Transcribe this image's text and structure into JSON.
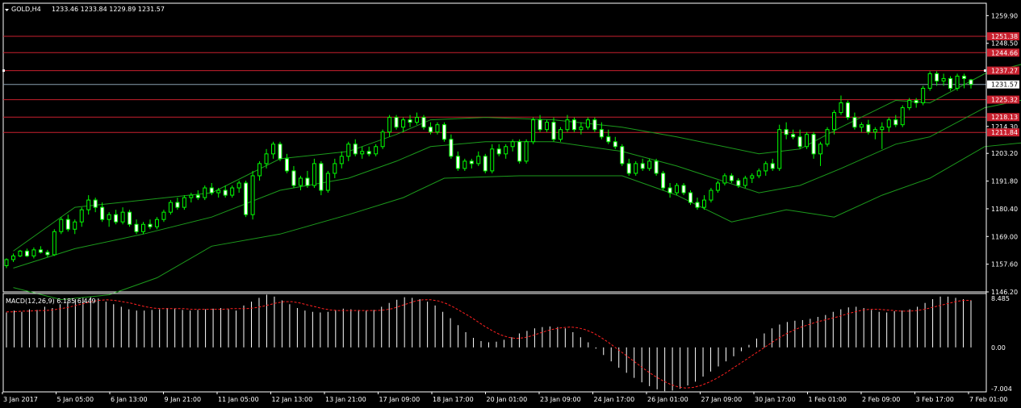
{
  "header": {
    "symbol": "GOLD,H4",
    "ohlc": "1233.46 1233.84 1229.89 1231.57"
  },
  "colors": {
    "background": "#000000",
    "foreground": "#ffffff",
    "bollinger": "#1c9a1c",
    "candle_up_border": "#00ff00",
    "candle_up_fill": "#000000",
    "candle_down_fill": "#ffffff",
    "level_line": "#c8202e",
    "level_tag": "#c8202e",
    "bid_line": "#8aa0b0",
    "macd_hist": "#ffffff",
    "macd_signal": "#ff2020"
  },
  "price_axis": {
    "tick_labels": [
      "1259.90",
      "1248.50",
      "1214.30",
      "1203.20",
      "1191.80",
      "1180.40",
      "1169.00",
      "1157.60",
      "1146.20"
    ],
    "current_price": "1231.57"
  },
  "levels": [
    {
      "value": 1251.38,
      "label": "1251.38"
    },
    {
      "value": 1244.66,
      "label": "1244.66"
    },
    {
      "value": 1237.27,
      "label": "1237.27"
    },
    {
      "value": 1225.32,
      "label": "1225.32"
    },
    {
      "value": 1218.13,
      "label": "1218.13"
    },
    {
      "value": 1211.84,
      "label": "1211.84"
    }
  ],
  "macd": {
    "title": "MACD(12,26,9) 6.185 6.449",
    "tick_labels": [
      "8.485",
      "0.00",
      "-7.004"
    ],
    "ylim": [
      -7.004,
      8.485
    ],
    "histogram": [
      5.5,
      5.8,
      5.6,
      6.0,
      5.9,
      6.4,
      6.2,
      6.8,
      7.2,
      7.6,
      7.8,
      7.9,
      7.7,
      7.2,
      6.8,
      6.4,
      6.0,
      5.8,
      5.8,
      5.9,
      6.0,
      6.2,
      6.1,
      5.9,
      5.8,
      5.9,
      6.0,
      6.1,
      6.2,
      6.0,
      5.8,
      6.6,
      7.2,
      7.8,
      8.3,
      8.0,
      7.4,
      6.8,
      6.2,
      5.8,
      5.6,
      5.5,
      5.6,
      5.9,
      6.1,
      6.0,
      5.9,
      5.8,
      5.9,
      6.4,
      7.0,
      7.5,
      7.9,
      7.8,
      7.6,
      7.2,
      6.6,
      5.6,
      4.6,
      3.5,
      2.4,
      1.5,
      1.0,
      0.8,
      0.9,
      1.2,
      1.6,
      2.2,
      2.6,
      3.0,
      3.2,
      3.3,
      3.2,
      3.0,
      2.4,
      1.6,
      0.8,
      -0.2,
      -1.2,
      -2.2,
      -3.2,
      -4.0,
      -4.8,
      -5.5,
      -6.1,
      -6.6,
      -6.9,
      -6.8,
      -6.5,
      -6.0,
      -5.4,
      -4.6,
      -3.8,
      -3.0,
      -2.2,
      -1.4,
      -0.6,
      0.4,
      1.4,
      2.2,
      3.0,
      3.6,
      4.0,
      4.2,
      4.3,
      4.5,
      4.8,
      5.1,
      5.6,
      6.0,
      6.3,
      6.4,
      6.2,
      5.9,
      5.6,
      5.5,
      5.7,
      5.8,
      6.0,
      6.4,
      7.0,
      7.6,
      8.0,
      8.0,
      7.8,
      7.6,
      7.4
    ],
    "signal": [
      5.6,
      5.6,
      5.7,
      5.7,
      5.8,
      5.8,
      5.9,
      6.1,
      6.3,
      6.6,
      6.9,
      7.2,
      7.4,
      7.5,
      7.4,
      7.2,
      7.0,
      6.7,
      6.4,
      6.2,
      6.1,
      6.1,
      6.1,
      6.1,
      6.0,
      6.0,
      6.0,
      6.0,
      6.0,
      6.1,
      6.1,
      6.1,
      6.2,
      6.4,
      6.7,
      7.0,
      7.2,
      7.2,
      7.0,
      6.7,
      6.4,
      6.1,
      5.9,
      5.8,
      5.8,
      5.8,
      5.8,
      5.8,
      5.8,
      5.9,
      6.1,
      6.5,
      6.9,
      7.3,
      7.5,
      7.5,
      7.3,
      6.9,
      6.3,
      5.6,
      4.9,
      4.1,
      3.3,
      2.6,
      2.0,
      1.6,
      1.4,
      1.5,
      1.8,
      2.2,
      2.6,
      2.9,
      3.1,
      3.2,
      3.1,
      2.8,
      2.3,
      1.6,
      0.8,
      -0.1,
      -1.0,
      -1.9,
      -2.8,
      -3.7,
      -4.5,
      -5.2,
      -5.8,
      -6.2,
      -6.4,
      -6.3,
      -6.0,
      -5.5,
      -4.9,
      -4.2,
      -3.4,
      -2.6,
      -1.8,
      -1.0,
      -0.2,
      0.6,
      1.4,
      2.1,
      2.7,
      3.2,
      3.6,
      4.0,
      4.3,
      4.6,
      4.9,
      5.3,
      5.6,
      5.9,
      6.0,
      6.0,
      5.9,
      5.8,
      5.7,
      5.7,
      5.8,
      6.0,
      6.3,
      6.6,
      6.9,
      7.2,
      7.4,
      7.4
    ]
  },
  "time_axis": {
    "labels": [
      "3 Jan 2017",
      "5 Jan 05:00",
      "6 Jan 13:00",
      "9 Jan 21:00",
      "11 Jan 05:00",
      "12 Jan 13:00",
      "13 Jan 21:00",
      "17 Jan 09:00",
      "18 Jan 17:00",
      "20 Jan 01:00",
      "23 Jan 09:00",
      "24 Jan 17:00",
      "26 Jan 01:00",
      "27 Jan 09:00",
      "30 Jan 17:00",
      "1 Feb 01:00",
      "2 Feb 09:00",
      "3 Feb 17:00",
      "7 Feb 01:00"
    ]
  },
  "chart_data": {
    "type": "candlestick",
    "title": "GOLD,H4",
    "ylim": [
      1146.2,
      1265.0
    ],
    "candles": [
      [
        1157.0,
        1160.0,
        1156.0,
        1159.5
      ],
      [
        1159.5,
        1162.0,
        1158.5,
        1161.0
      ],
      [
        1161.0,
        1163.5,
        1160.5,
        1163.0
      ],
      [
        1163.0,
        1164.0,
        1160.5,
        1161.0
      ],
      [
        1161.0,
        1164.5,
        1160.0,
        1163.5
      ],
      [
        1163.5,
        1165.0,
        1162.0,
        1162.5
      ],
      [
        1162.5,
        1163.5,
        1160.5,
        1161.5
      ],
      [
        1161.5,
        1172.0,
        1161.0,
        1171.0
      ],
      [
        1171.0,
        1177.0,
        1170.0,
        1176.0
      ],
      [
        1176.0,
        1178.0,
        1171.0,
        1172.0
      ],
      [
        1172.0,
        1176.0,
        1170.0,
        1175.0
      ],
      [
        1175.0,
        1181.0,
        1173.0,
        1180.0
      ],
      [
        1180.0,
        1186.0,
        1178.0,
        1184.0
      ],
      [
        1184.0,
        1185.0,
        1179.0,
        1181.0
      ],
      [
        1181.0,
        1183.0,
        1175.0,
        1176.0
      ],
      [
        1176.0,
        1179.0,
        1173.0,
        1178.0
      ],
      [
        1178.0,
        1180.0,
        1174.0,
        1175.0
      ],
      [
        1175.0,
        1181.0,
        1174.0,
        1179.0
      ],
      [
        1179.0,
        1180.0,
        1173.0,
        1174.0
      ],
      [
        1174.0,
        1176.0,
        1170.0,
        1171.0
      ],
      [
        1171.0,
        1175.0,
        1170.0,
        1174.0
      ],
      [
        1174.0,
        1176.0,
        1172.0,
        1173.0
      ],
      [
        1173.0,
        1177.0,
        1172.0,
        1176.0
      ],
      [
        1176.0,
        1180.0,
        1175.0,
        1179.0
      ],
      [
        1179.0,
        1184.0,
        1178.0,
        1183.0
      ],
      [
        1183.0,
        1185.0,
        1180.0,
        1181.0
      ],
      [
        1181.0,
        1186.0,
        1180.0,
        1185.0
      ],
      [
        1185.0,
        1187.0,
        1183.0,
        1186.0
      ],
      [
        1186.0,
        1188.0,
        1184.0,
        1185.0
      ],
      [
        1185.0,
        1190.0,
        1184.0,
        1189.0
      ],
      [
        1189.0,
        1191.0,
        1186.0,
        1187.0
      ],
      [
        1187.0,
        1189.0,
        1185.0,
        1188.0
      ],
      [
        1188.0,
        1190.0,
        1185.0,
        1186.0
      ],
      [
        1186.0,
        1190.0,
        1185.0,
        1189.0
      ],
      [
        1189.0,
        1192.0,
        1187.0,
        1191.0
      ],
      [
        1191.0,
        1192.0,
        1177.0,
        1178.0
      ],
      [
        1178.0,
        1196.0,
        1176.0,
        1194.0
      ],
      [
        1194.0,
        1200.0,
        1192.0,
        1199.0
      ],
      [
        1199.0,
        1205.0,
        1197.0,
        1203.0
      ],
      [
        1203.0,
        1208.0,
        1201.0,
        1207.0
      ],
      [
        1207.0,
        1208.0,
        1200.0,
        1201.0
      ],
      [
        1201.0,
        1203.0,
        1195.0,
        1196.0
      ],
      [
        1196.0,
        1198.0,
        1189.0,
        1190.0
      ],
      [
        1190.0,
        1194.0,
        1188.0,
        1193.0
      ],
      [
        1193.0,
        1196.0,
        1189.0,
        1190.0
      ],
      [
        1190.0,
        1201.0,
        1189.0,
        1199.0
      ],
      [
        1199.0,
        1200.0,
        1186.0,
        1188.0
      ],
      [
        1188.0,
        1196.0,
        1187.0,
        1195.0
      ],
      [
        1195.0,
        1201.0,
        1193.0,
        1199.0
      ],
      [
        1199.0,
        1204.0,
        1197.0,
        1202.0
      ],
      [
        1202.0,
        1208.0,
        1200.0,
        1207.0
      ],
      [
        1207.0,
        1209.0,
        1202.0,
        1203.0
      ],
      [
        1203.0,
        1206.0,
        1201.0,
        1204.0
      ],
      [
        1204.0,
        1206.0,
        1202.0,
        1203.0
      ],
      [
        1203.0,
        1207.0,
        1202.0,
        1206.0
      ],
      [
        1206.0,
        1213.0,
        1205.0,
        1212.0
      ],
      [
        1212.0,
        1219.0,
        1210.0,
        1218.0
      ],
      [
        1218.0,
        1219.0,
        1213.0,
        1214.0
      ],
      [
        1214.0,
        1218.0,
        1212.0,
        1217.0
      ],
      [
        1217.0,
        1219.0,
        1214.0,
        1216.0
      ],
      [
        1216.0,
        1220.0,
        1215.0,
        1218.0
      ],
      [
        1218.0,
        1219.0,
        1213.0,
        1214.0
      ],
      [
        1214.0,
        1216.0,
        1211.0,
        1212.0
      ],
      [
        1212.0,
        1216.0,
        1211.0,
        1215.0
      ],
      [
        1215.0,
        1216.0,
        1208.0,
        1209.0
      ],
      [
        1209.0,
        1211.0,
        1201.0,
        1202.0
      ],
      [
        1202.0,
        1204.0,
        1196.0,
        1197.0
      ],
      [
        1197.0,
        1201.0,
        1196.0,
        1200.0
      ],
      [
        1200.0,
        1201.0,
        1197.0,
        1199.0
      ],
      [
        1199.0,
        1204.0,
        1198.0,
        1202.0
      ],
      [
        1202.0,
        1203.0,
        1195.0,
        1196.0
      ],
      [
        1196.0,
        1207.0,
        1195.0,
        1205.0
      ],
      [
        1205.0,
        1207.0,
        1202.0,
        1203.0
      ],
      [
        1203.0,
        1207.0,
        1201.0,
        1206.0
      ],
      [
        1206.0,
        1209.0,
        1204.0,
        1208.0
      ],
      [
        1208.0,
        1209.0,
        1199.0,
        1200.0
      ],
      [
        1200.0,
        1209.0,
        1199.0,
        1208.0
      ],
      [
        1208.0,
        1218.0,
        1207.0,
        1217.0
      ],
      [
        1217.0,
        1219.0,
        1212.0,
        1213.0
      ],
      [
        1213.0,
        1217.0,
        1212.0,
        1216.0
      ],
      [
        1216.0,
        1218.0,
        1208.0,
        1209.0
      ],
      [
        1209.0,
        1214.0,
        1208.0,
        1213.0
      ],
      [
        1213.0,
        1219.0,
        1212.0,
        1217.0
      ],
      [
        1217.0,
        1218.0,
        1212.0,
        1213.0
      ],
      [
        1213.0,
        1216.0,
        1211.0,
        1214.0
      ],
      [
        1214.0,
        1218.0,
        1213.0,
        1217.0
      ],
      [
        1217.0,
        1218.0,
        1212.0,
        1213.0
      ],
      [
        1213.0,
        1216.0,
        1209.0,
        1210.0
      ],
      [
        1210.0,
        1213.0,
        1207.0,
        1208.0
      ],
      [
        1208.0,
        1210.0,
        1205.0,
        1206.0
      ],
      [
        1206.0,
        1207.0,
        1198.0,
        1199.0
      ],
      [
        1199.0,
        1201.0,
        1194.0,
        1195.0
      ],
      [
        1195.0,
        1200.0,
        1194.0,
        1199.0
      ],
      [
        1199.0,
        1201.0,
        1196.0,
        1197.0
      ],
      [
        1197.0,
        1201.0,
        1196.0,
        1200.0
      ],
      [
        1200.0,
        1201.0,
        1194.0,
        1195.0
      ],
      [
        1195.0,
        1196.0,
        1188.0,
        1189.0
      ],
      [
        1189.0,
        1191.0,
        1185.0,
        1187.0
      ],
      [
        1187.0,
        1191.0,
        1186.0,
        1190.0
      ],
      [
        1190.0,
        1191.0,
        1186.0,
        1187.0
      ],
      [
        1187.0,
        1188.0,
        1182.0,
        1183.0
      ],
      [
        1183.0,
        1185.0,
        1180.0,
        1181.0
      ],
      [
        1181.0,
        1186.0,
        1180.0,
        1184.0
      ],
      [
        1184.0,
        1189.0,
        1183.0,
        1188.0
      ],
      [
        1188.0,
        1192.0,
        1187.0,
        1191.0
      ],
      [
        1191.0,
        1195.0,
        1190.0,
        1194.0
      ],
      [
        1194.0,
        1195.0,
        1191.0,
        1192.0
      ],
      [
        1192.0,
        1193.0,
        1189.0,
        1190.0
      ],
      [
        1190.0,
        1194.0,
        1189.0,
        1193.0
      ],
      [
        1193.0,
        1195.0,
        1191.0,
        1194.0
      ],
      [
        1194.0,
        1197.0,
        1193.0,
        1196.0
      ],
      [
        1196.0,
        1200.0,
        1194.0,
        1199.0
      ],
      [
        1199.0,
        1201.0,
        1196.0,
        1197.0
      ],
      [
        1197.0,
        1215.0,
        1196.0,
        1213.0
      ],
      [
        1213.0,
        1216.0,
        1209.0,
        1211.0
      ],
      [
        1211.0,
        1213.0,
        1209.0,
        1210.0
      ],
      [
        1210.0,
        1213.0,
        1205.0,
        1206.0
      ],
      [
        1206.0,
        1212.0,
        1205.0,
        1211.0
      ],
      [
        1211.0,
        1212.0,
        1201.0,
        1203.0
      ],
      [
        1203.0,
        1208.0,
        1198.0,
        1207.0
      ],
      [
        1207.0,
        1214.0,
        1206.0,
        1213.0
      ],
      [
        1213.0,
        1221.0,
        1211.0,
        1220.0
      ],
      [
        1220.0,
        1227.0,
        1219.0,
        1224.0
      ],
      [
        1224.0,
        1225.0,
        1217.0,
        1218.0
      ],
      [
        1218.0,
        1220.0,
        1213.0,
        1214.0
      ],
      [
        1214.0,
        1216.0,
        1212.0,
        1215.0
      ],
      [
        1215.0,
        1217.0,
        1211.0,
        1212.0
      ],
      [
        1212.0,
        1214.0,
        1209.0,
        1213.0
      ],
      [
        1213.0,
        1216.0,
        1205.0,
        1214.0
      ],
      [
        1214.0,
        1218.0,
        1212.0,
        1217.0
      ],
      [
        1217.0,
        1219.0,
        1214.0,
        1215.0
      ],
      [
        1215.0,
        1223.0,
        1214.0,
        1222.0
      ],
      [
        1222.0,
        1226.0,
        1221.0,
        1225.0
      ],
      [
        1225.0,
        1226.0,
        1222.0,
        1224.0
      ],
      [
        1224.0,
        1231.0,
        1223.0,
        1230.0
      ],
      [
        1230.0,
        1237.0,
        1229.0,
        1236.0
      ],
      [
        1236.0,
        1237.0,
        1231.0,
        1233.0
      ],
      [
        1233.0,
        1236.0,
        1231.0,
        1234.0
      ],
      [
        1234.0,
        1235.0,
        1229.0,
        1230.0
      ],
      [
        1230.0,
        1236.0,
        1229.0,
        1235.0
      ],
      [
        1235.0,
        1236.0,
        1230.0,
        1234.0
      ],
      [
        1233.46,
        1233.84,
        1229.89,
        1231.57
      ]
    ],
    "bollinger": {
      "upper": [
        [
          1,
          1163
        ],
        [
          10,
          1181
        ],
        [
          20,
          1184
        ],
        [
          30,
          1187
        ],
        [
          40,
          1201
        ],
        [
          50,
          1204
        ],
        [
          57,
          1211
        ],
        [
          62,
          1217
        ],
        [
          70,
          1218
        ],
        [
          80,
          1217
        ],
        [
          90,
          1214
        ],
        [
          98,
          1210
        ],
        [
          110,
          1203
        ],
        [
          116,
          1205
        ],
        [
          122,
          1214
        ],
        [
          130,
          1225
        ],
        [
          135,
          1224
        ],
        [
          143,
          1236
        ],
        [
          150,
          1241
        ]
      ],
      "middle": [
        [
          1,
          1156
        ],
        [
          10,
          1164
        ],
        [
          20,
          1170
        ],
        [
          30,
          1177
        ],
        [
          40,
          1188
        ],
        [
          50,
          1193
        ],
        [
          57,
          1200
        ],
        [
          62,
          1206
        ],
        [
          70,
          1208
        ],
        [
          80,
          1208
        ],
        [
          90,
          1204
        ],
        [
          98,
          1198
        ],
        [
          110,
          1187
        ],
        [
          116,
          1190
        ],
        [
          122,
          1197
        ],
        [
          130,
          1207
        ],
        [
          135,
          1210
        ],
        [
          143,
          1222
        ],
        [
          150,
          1226
        ]
      ],
      "lower": [
        [
          1,
          1148
        ],
        [
          8,
          1143
        ],
        [
          15,
          1145
        ],
        [
          22,
          1152
        ],
        [
          30,
          1165
        ],
        [
          40,
          1170
        ],
        [
          50,
          1178
        ],
        [
          58,
          1185
        ],
        [
          64,
          1193
        ],
        [
          75,
          1194
        ],
        [
          90,
          1194
        ],
        [
          98,
          1186
        ],
        [
          106,
          1175
        ],
        [
          114,
          1180
        ],
        [
          121,
          1177
        ],
        [
          128,
          1186
        ],
        [
          135,
          1193
        ],
        [
          143,
          1206
        ],
        [
          150,
          1208
        ]
      ]
    },
    "price_scale_ticks": [
      1259.9,
      1248.5,
      1214.3,
      1203.2,
      1191.8,
      1180.4,
      1169.0,
      1157.6,
      1146.2
    ]
  }
}
